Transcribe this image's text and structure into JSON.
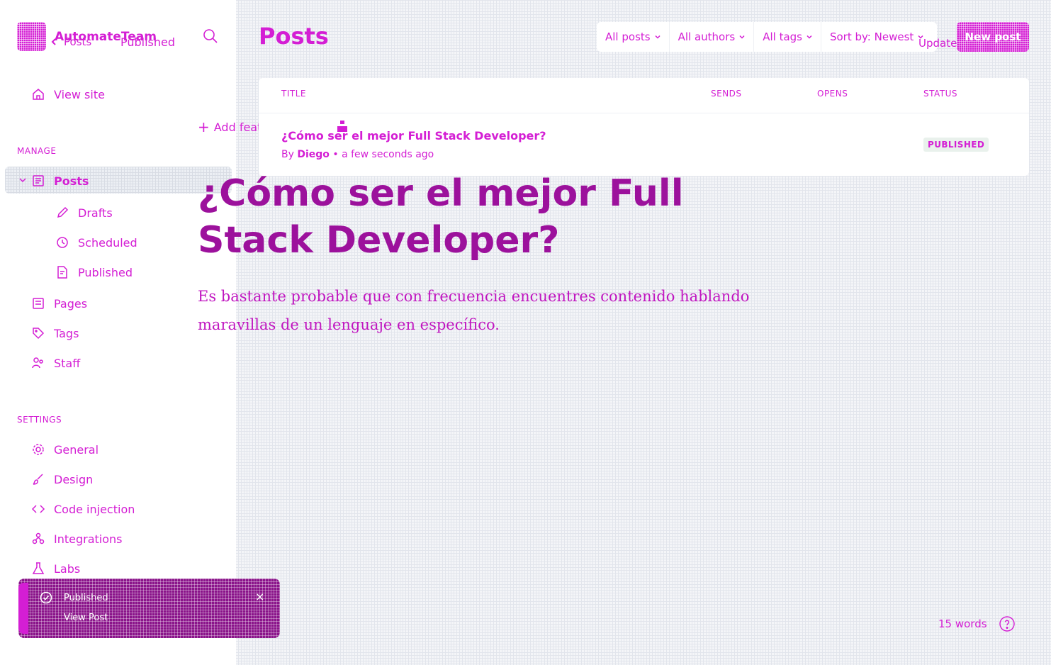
{
  "brand": {
    "name": "AutomateTeam"
  },
  "editor": {
    "back_label": "Posts",
    "status": "Published",
    "add_feature_image": "Add feature image",
    "title": "¿Cómo ser el mejor Full Stack Developer?",
    "excerpt": "Es bastante probable que con frecuencia encuentres contenido hablando maravillas de un lenguaje en específico.",
    "word_count": "15 words",
    "update_label": "Update"
  },
  "sidebar": {
    "view_site": "View site",
    "manage_title": "MANAGE",
    "posts": "Posts",
    "sub_items": [
      "Drafts",
      "Scheduled",
      "Published"
    ],
    "pages": "Pages",
    "tags": "Tags",
    "staff": "Staff",
    "settings_title": "SETTINGS",
    "settings_items": [
      "General",
      "Design",
      "Code injection",
      "Integrations",
      "Labs"
    ]
  },
  "header": {
    "title": "Posts",
    "filters": [
      "All posts",
      "All authors",
      "All tags",
      "Sort by: Newest"
    ],
    "new_post": "New post"
  },
  "table": {
    "columns": [
      "TITLE",
      "SENDS",
      "OPENS",
      "STATUS"
    ],
    "rows": [
      {
        "title": "¿Cómo ser el mejor Full Stack Developer?",
        "by": "By",
        "author": "Diego",
        "time": "• a few seconds ago",
        "status": "PUBLISHED"
      }
    ]
  },
  "toast": {
    "title": "Published",
    "link": "View Post",
    "close": "×"
  },
  "colors": {
    "accent": "#d41ed4",
    "title": "#9c119c",
    "toast_bg": "#8a148a",
    "badge_bg": "#e9f1ec"
  }
}
